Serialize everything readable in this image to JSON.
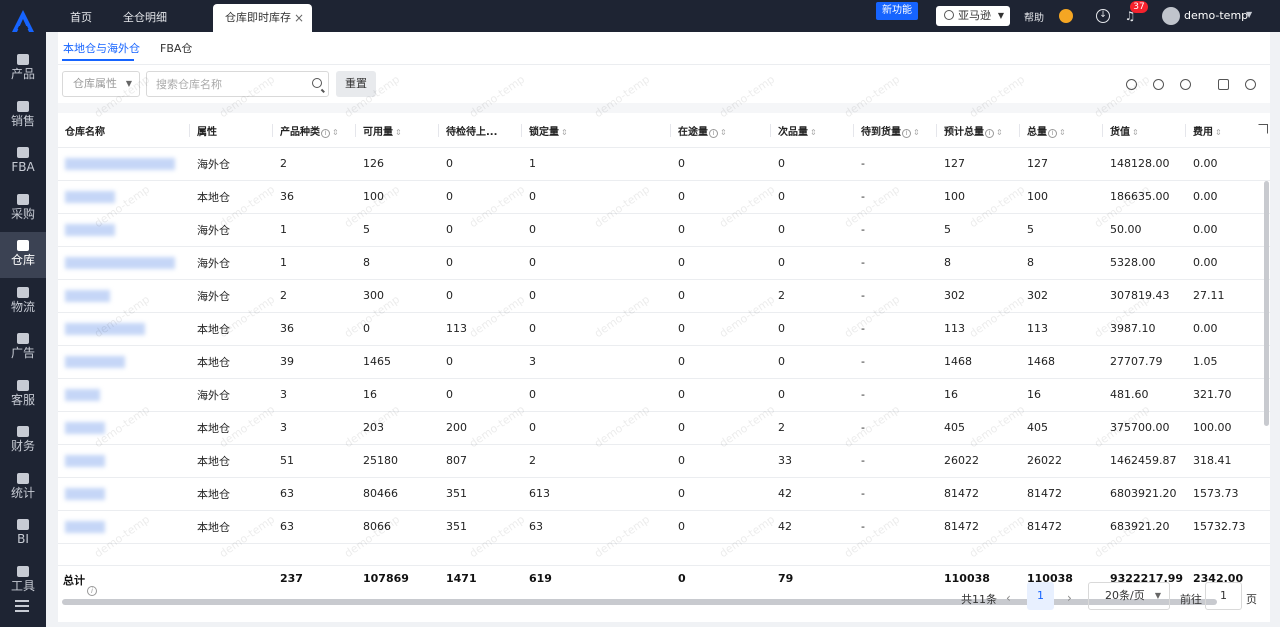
{
  "nav": [
    {
      "label": "产品",
      "icon": "product-icon"
    },
    {
      "label": "销售",
      "icon": "sales-icon"
    },
    {
      "label": "FBA",
      "icon": "fba-icon"
    },
    {
      "label": "采购",
      "icon": "purchase-icon"
    },
    {
      "label": "仓库",
      "icon": "warehouse-icon",
      "active": true
    },
    {
      "label": "物流",
      "icon": "logistics-icon"
    },
    {
      "label": "广告",
      "icon": "ad-icon"
    },
    {
      "label": "客服",
      "icon": "service-icon"
    },
    {
      "label": "财务",
      "icon": "finance-icon"
    },
    {
      "label": "统计",
      "icon": "stats-icon"
    },
    {
      "label": "BI",
      "icon": "bi-icon"
    },
    {
      "label": "工具",
      "icon": "tools-icon"
    }
  ],
  "tabs": {
    "home": "首页",
    "detail": "全仓明细",
    "current": "仓库即时库存",
    "close": "×"
  },
  "header": {
    "new_feature": "新功能",
    "store": "亚马逊",
    "help": "帮助",
    "notifications": "37",
    "username": "demo-temp"
  },
  "subtabs": {
    "local": "本地仓与海外仓",
    "fba": "FBA仓"
  },
  "filters": {
    "warehouse_attr": "仓库属性",
    "search_placeholder": "搜索仓库名称",
    "reset": "重置"
  },
  "table": {
    "columns": {
      "name": "仓库名称",
      "attr": "属性",
      "sku_types": "产品种类",
      "available": "可用量",
      "pending": "待检待上...",
      "locked": "锁定量",
      "transit": "在途量",
      "defective": "次品量",
      "awaiting": "待到货量",
      "expected": "预计总量",
      "total": "总量",
      "value": "货值",
      "fee": "费用"
    },
    "rows": [
      {
        "attr": "海外仓",
        "types": "2",
        "available": "126",
        "pending": "0",
        "locked": "1",
        "transit": "0",
        "defective": "0",
        "awaiting": "-",
        "expected": "127",
        "total": "127",
        "value": "148128.00",
        "fee": "0.00"
      },
      {
        "attr": "本地仓",
        "types": "36",
        "available": "100",
        "pending": "0",
        "locked": "0",
        "transit": "0",
        "defective": "0",
        "awaiting": "-",
        "expected": "100",
        "total": "100",
        "value": "186635.00",
        "fee": "0.00"
      },
      {
        "attr": "海外仓",
        "types": "1",
        "available": "5",
        "pending": "0",
        "locked": "0",
        "transit": "0",
        "defective": "0",
        "awaiting": "-",
        "expected": "5",
        "total": "5",
        "value": "50.00",
        "fee": "0.00"
      },
      {
        "attr": "海外仓",
        "types": "1",
        "available": "8",
        "pending": "0",
        "locked": "0",
        "transit": "0",
        "defective": "0",
        "awaiting": "-",
        "expected": "8",
        "total": "8",
        "value": "5328.00",
        "fee": "0.00"
      },
      {
        "attr": "海外仓",
        "types": "2",
        "available": "300",
        "pending": "0",
        "locked": "0",
        "transit": "0",
        "defective": "2",
        "awaiting": "-",
        "expected": "302",
        "total": "302",
        "value": "307819.43",
        "fee": "27.11"
      },
      {
        "attr": "本地仓",
        "types": "36",
        "available": "0",
        "pending": "113",
        "locked": "0",
        "transit": "0",
        "defective": "0",
        "awaiting": "-",
        "expected": "113",
        "total": "113",
        "value": "3987.10",
        "fee": "0.00"
      },
      {
        "attr": "本地仓",
        "types": "39",
        "available": "1465",
        "pending": "0",
        "locked": "3",
        "transit": "0",
        "defective": "0",
        "awaiting": "-",
        "expected": "1468",
        "total": "1468",
        "value": "27707.79",
        "fee": "1.05"
      },
      {
        "attr": "海外仓",
        "types": "3",
        "available": "16",
        "pending": "0",
        "locked": "0",
        "transit": "0",
        "defective": "0",
        "awaiting": "-",
        "expected": "16",
        "total": "16",
        "value": "481.60",
        "fee": "321.70"
      },
      {
        "attr": "本地仓",
        "types": "3",
        "available": "203",
        "pending": "200",
        "locked": "0",
        "transit": "0",
        "defective": "2",
        "awaiting": "-",
        "expected": "405",
        "total": "405",
        "value": "375700.00",
        "fee": "100.00"
      },
      {
        "attr": "本地仓",
        "types": "51",
        "available": "25180",
        "pending": "807",
        "locked": "2",
        "transit": "0",
        "defective": "33",
        "awaiting": "-",
        "expected": "26022",
        "total": "26022",
        "value": "1462459.87",
        "fee": "318.41"
      },
      {
        "attr": "本地仓",
        "types": "63",
        "available": "80466",
        "pending": "351",
        "locked": "613",
        "transit": "0",
        "defective": "42",
        "awaiting": "-",
        "expected": "81472",
        "total": "81472",
        "value": "6803921.20",
        "fee": "1573.73"
      },
      {
        "attr": "本地仓",
        "types": "63",
        "available": "8066",
        "pending": "351",
        "locked": "63",
        "transit": "0",
        "defective": "42",
        "awaiting": "-",
        "expected": "81472",
        "total": "81472",
        "value": "683921.20",
        "fee": "15732.73"
      }
    ],
    "summary": {
      "label": "总计",
      "types": "237",
      "available": "107869",
      "pending": "1471",
      "locked": "619",
      "transit": "0",
      "defective": "79",
      "expected": "110038",
      "total": "110038",
      "value": "9322217.99",
      "fee": "2342.00"
    }
  },
  "pagination": {
    "total": "共11条",
    "current": "1",
    "size": "20条/页",
    "jump_label": "前往",
    "jump_value": "1",
    "jump_suffix": "页"
  },
  "watermark": "demo-temp"
}
